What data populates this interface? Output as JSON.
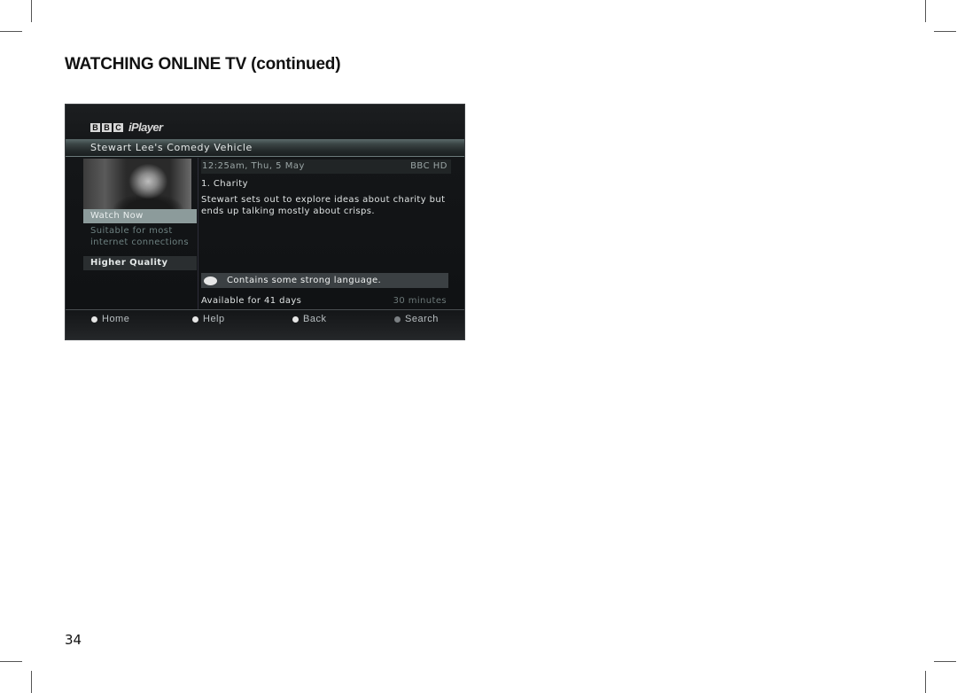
{
  "page": {
    "heading": "WATCHING ONLINE TV (continued)",
    "page_number": "34"
  },
  "screen": {
    "logo": {
      "bbc_letters": [
        "B",
        "B",
        "C"
      ],
      "product": "iPlayer"
    },
    "programme_title": "Stewart Lee's Comedy Vehicle",
    "thumbnail": "programme-thumbnail",
    "menu": {
      "watch_now": "Watch Now",
      "watch_now_note": "Suitable for most internet connections",
      "higher_quality": "Higher Quality"
    },
    "info": {
      "datetime": "12:25am, Thu, 5 May",
      "channel": "BBC HD",
      "episode": "1. Charity",
      "description": "Stewart sets out to explore ideas about charity but ends up talking mostly about crisps.",
      "warning": "Contains some strong language.",
      "availability": "Available for 41 days",
      "duration": "30 minutes"
    },
    "footer": [
      {
        "label": "Home",
        "icon": "button-dot-icon"
      },
      {
        "label": "Help",
        "icon": "button-dot-icon"
      },
      {
        "label": "Back",
        "icon": "button-dot-icon"
      },
      {
        "label": "Search",
        "icon": "button-dot-icon"
      }
    ]
  }
}
